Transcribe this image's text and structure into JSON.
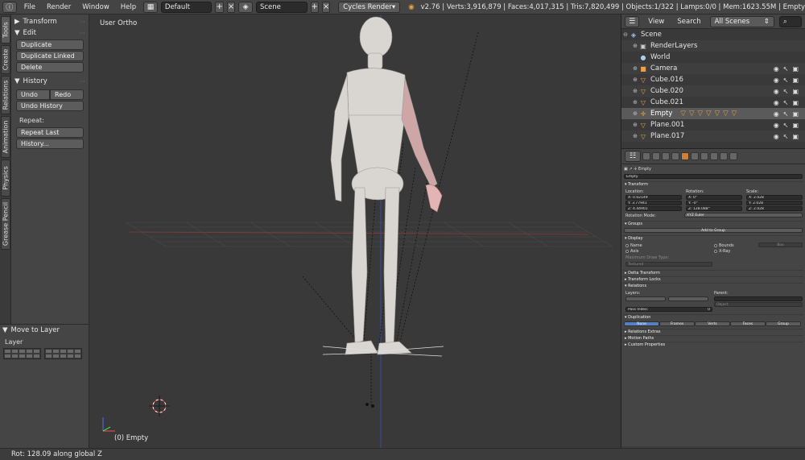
{
  "topbar": {
    "menus": [
      "File",
      "Render",
      "Window",
      "Help"
    ],
    "layout": "Default",
    "scene": "Scene",
    "engine": "Cycles Render",
    "stats": "v2.76 | Verts:3,916,879 | Faces:4,017,315 | Tris:7,820,499 | Objects:1/322 | Lamps:0/0 | Mem:1623.55M | Empty"
  },
  "vtabs": [
    "Tools",
    "Create",
    "Relations",
    "Animation",
    "Physics",
    "Grease Pencil"
  ],
  "toolshelf": {
    "transform": "Transform",
    "edit": "Edit",
    "duplicate": "Duplicate",
    "duplicate_linked": "Duplicate Linked",
    "delete": "Delete",
    "history": "History",
    "undo": "Undo",
    "redo": "Redo",
    "undo_history": "Undo History",
    "repeat": "Repeat:",
    "repeat_last": "Repeat Last",
    "history_dots": "History..."
  },
  "operator": {
    "title": "Move to Layer",
    "layer": "Layer"
  },
  "viewport": {
    "view_label": "User Ortho",
    "object_label": "(0) Empty"
  },
  "status": "Rot: 128.09 along global Z",
  "outliner": {
    "view": "View",
    "search": "Search",
    "filter": "All Scenes",
    "rows": [
      {
        "name": "Scene",
        "kind": "scene"
      },
      {
        "name": "RenderLayers",
        "kind": "renderlayers"
      },
      {
        "name": "World",
        "kind": "world"
      },
      {
        "name": "Camera",
        "kind": "camera"
      },
      {
        "name": "Cube.016",
        "kind": "mesh"
      },
      {
        "name": "Cube.020",
        "kind": "mesh"
      },
      {
        "name": "Cube.021",
        "kind": "mesh"
      },
      {
        "name": "Empty",
        "kind": "empty"
      },
      {
        "name": "Plane.001",
        "kind": "mesh"
      },
      {
        "name": "Plane.017",
        "kind": "mesh"
      }
    ]
  },
  "properties": {
    "breadcrumb": "Empty",
    "name": "Empty",
    "transform": "Transform",
    "location": "Location:",
    "rotation": "Rotation:",
    "scale": "Scale:",
    "loc": [
      "X:  0.02149",
      "Y:  3.77941",
      "Z:  4.44901"
    ],
    "rot": [
      "X:  0°",
      "Y:  -0°",
      "Z:  128.088°"
    ],
    "scl": [
      "X:  2.028",
      "Y:  2.028",
      "Z:  2.028"
    ],
    "rotation_mode_label": "Rotation Mode:",
    "rotation_mode": "XYZ Euler",
    "groups": "Groups",
    "add_to_group": "Add to Group",
    "display": "Display",
    "name_opt": "Name",
    "axis_opt": "Axis",
    "bounds_opt": "Bounds",
    "xray_opt": "X-Ray",
    "box": "Box",
    "max_draw": "Maximum Draw Type:",
    "textured": "Textured",
    "delta": "Delta Transform",
    "locks": "Transform Locks",
    "relations": "Relations",
    "layers": "Layers:",
    "parent": "Parent:",
    "object": "Object",
    "pass_index": "Pass Index:",
    "pass_value": "0",
    "duplication": "Duplication",
    "dup_opts": [
      "None",
      "Frames",
      "Verts",
      "Faces",
      "Group"
    ],
    "relations_extras": "Relations Extras",
    "motion_paths": "Motion Paths",
    "custom_props": "Custom Properties"
  }
}
